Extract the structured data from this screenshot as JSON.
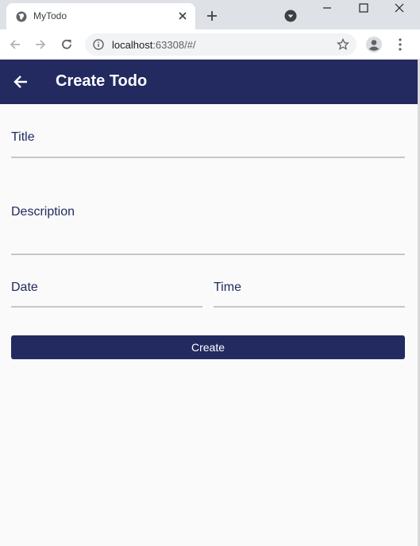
{
  "browser": {
    "tab": {
      "title": "MyTodo",
      "favicon": "globe-icon"
    },
    "address": {
      "host": "localhost",
      "rest": ":63308/#/"
    }
  },
  "app": {
    "title": "Create Todo",
    "back_icon": "arrow-left-icon",
    "accent": "#222a60"
  },
  "form": {
    "title_label": "Title",
    "description_label": "Description",
    "date_label": "Date",
    "time_label": "Time",
    "submit_label": "Create"
  }
}
